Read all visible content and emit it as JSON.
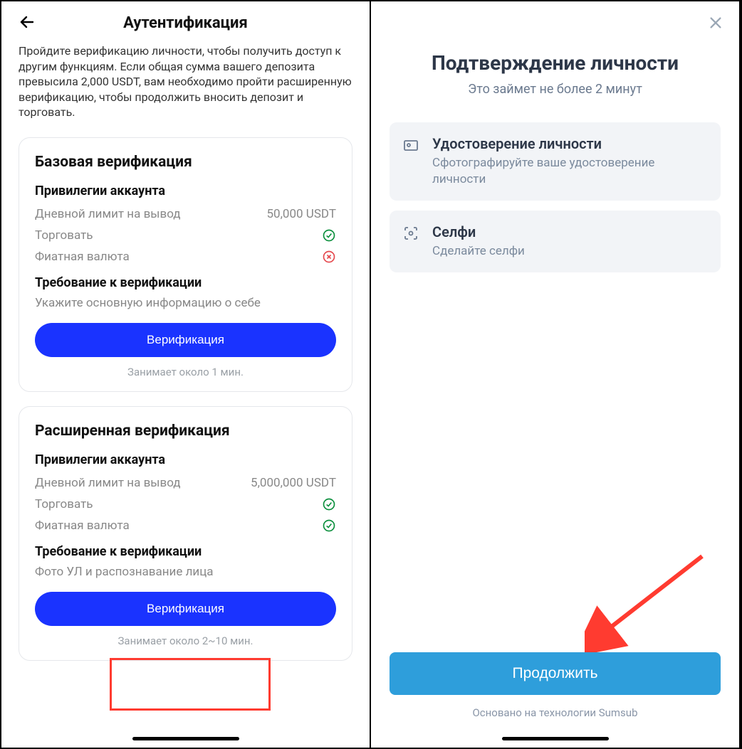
{
  "left": {
    "title": "Аутентификация",
    "intro": "Пройдите верификацию личности, чтобы получить доступ к другим функциям. Если общая сумма вашего депозита превысила 2,000 USDT, вам необходимо пройти расширенную верификацию, чтобы продолжить вносить депозит и торговать.",
    "basic": {
      "title": "Базовая верификация",
      "privileges_label": "Привилегии аккаунта",
      "withdraw_label": "Дневной лимит на вывод",
      "withdraw_value": "50,000 USDT",
      "trade_label": "Торговать",
      "fiat_label": "Фиатная валюта",
      "req_label": "Требование к верификации",
      "req_desc": "Укажите основную информацию о себе",
      "button": "Верификация",
      "time": "Занимает около 1 мин."
    },
    "advanced": {
      "title": "Расширенная верификация",
      "privileges_label": "Привилегии аккаунта",
      "withdraw_label": "Дневной лимит на вывод",
      "withdraw_value": "5,000,000 USDT",
      "trade_label": "Торговать",
      "fiat_label": "Фиатная валюта",
      "req_label": "Требование к верификации",
      "req_desc": "Фото УЛ и распознавание лица",
      "button": "Верификация",
      "time": "Занимает около 2~10 мин."
    }
  },
  "right": {
    "title": "Подтверждение личности",
    "subtitle": "Это займет не более 2 минут",
    "steps": {
      "id": {
        "title": "Удостоверение личности",
        "desc": "Сфотографируйте ваше удостоверение личности"
      },
      "selfie": {
        "title": "Селфи",
        "desc": "Сделайте селфи"
      }
    },
    "continue": "Продолжить",
    "powered": "Основано на технологии Sumsub"
  }
}
